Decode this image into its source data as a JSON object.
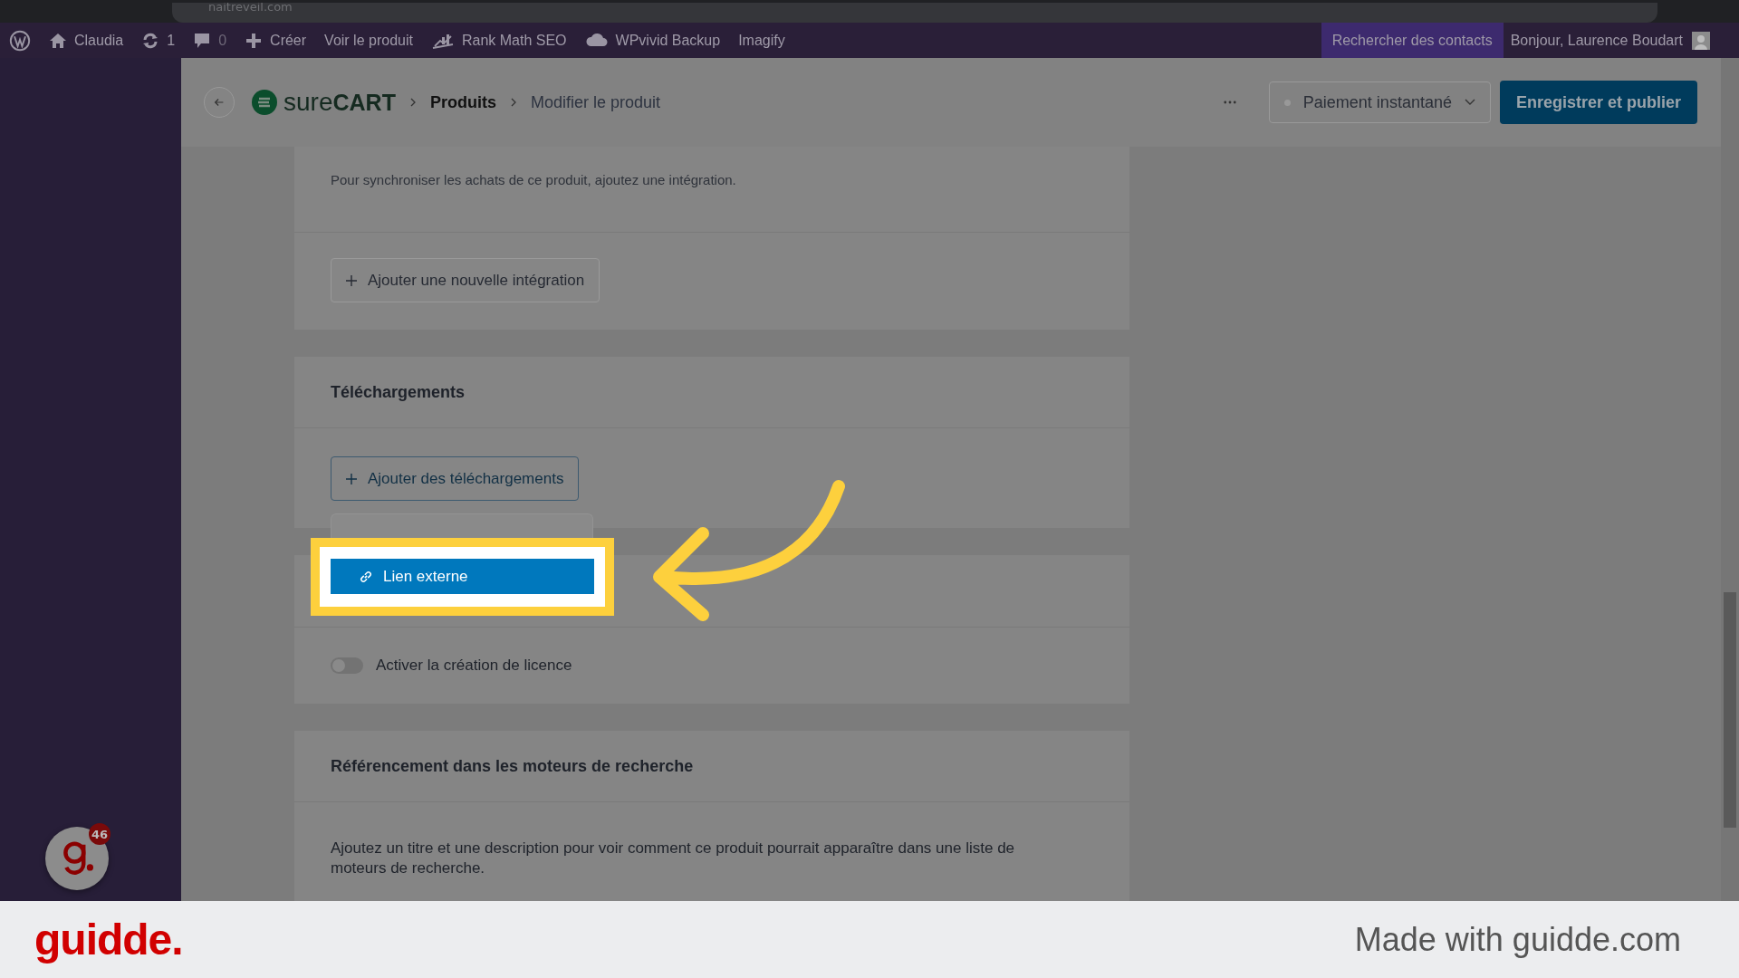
{
  "browser": {
    "url": "naitreveil.com"
  },
  "admin_bar": {
    "items": [
      {
        "kind": "wp"
      },
      {
        "kind": "home",
        "label": "Claudia"
      },
      {
        "kind": "updates",
        "label": "1"
      },
      {
        "kind": "comments",
        "label": "0"
      },
      {
        "kind": "new",
        "label": "Créer"
      },
      {
        "kind": "text",
        "label": "Voir le produit"
      },
      {
        "kind": "chart",
        "label": "Rank Math SEO"
      },
      {
        "kind": "cloud",
        "label": "WPvivid Backup"
      },
      {
        "kind": "text",
        "label": "Imagify"
      }
    ],
    "search_contacts": "Rechercher des contacts",
    "greeting": "Bonjour, Laurence Boudart"
  },
  "header": {
    "logo": [
      "sure",
      "CART"
    ],
    "breadcrumb": [
      "Produits",
      "Modifier le produit"
    ],
    "status": "Paiement instantané",
    "publish": "Enregistrer et publier"
  },
  "integrations": {
    "text": "Pour synchroniser les achats de ce produit, ajoutez une intégration.",
    "button": "Ajouter une nouvelle intégration"
  },
  "downloads": {
    "title": "Téléchargements",
    "button": "Ajouter des téléchargements",
    "menu": [
      {
        "label": "Lien externe",
        "selected": true
      }
    ]
  },
  "license": {
    "label": "Activer la création de licence",
    "on": false
  },
  "seo": {
    "title": "Référencement dans les moteurs de recherche",
    "text": "Ajoutez un titre et une description pour voir comment ce produit pourrait apparaître dans une liste de moteurs de recherche."
  },
  "guidde": {
    "badge": "46",
    "logo": "guidde.",
    "credit": "Made with guidde.com"
  }
}
